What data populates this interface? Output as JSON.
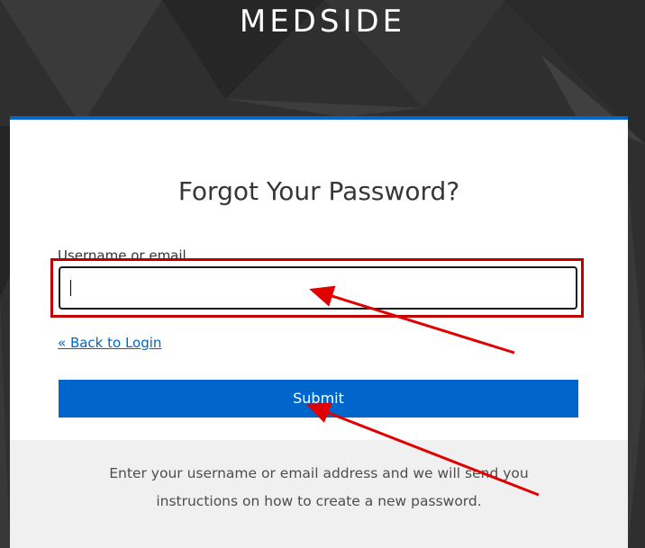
{
  "brand": {
    "name": "MEDSIDE"
  },
  "card": {
    "title": "Forgot Your Password?",
    "username_label": "Username or email",
    "username_value": "",
    "back_link": "« Back to Login",
    "submit_label": "Submit",
    "info_line_1": "Enter your username or email address and we will send you",
    "info_line_2": "instructions on how to create a new password."
  },
  "colors": {
    "accent": "#0066cc",
    "annotation": "#e00000",
    "background": "#2e2e2e"
  },
  "annotations": {
    "highlight": "red-outline-box",
    "arrows": [
      "arrow-to-username-input",
      "arrow-to-submit-button"
    ]
  }
}
